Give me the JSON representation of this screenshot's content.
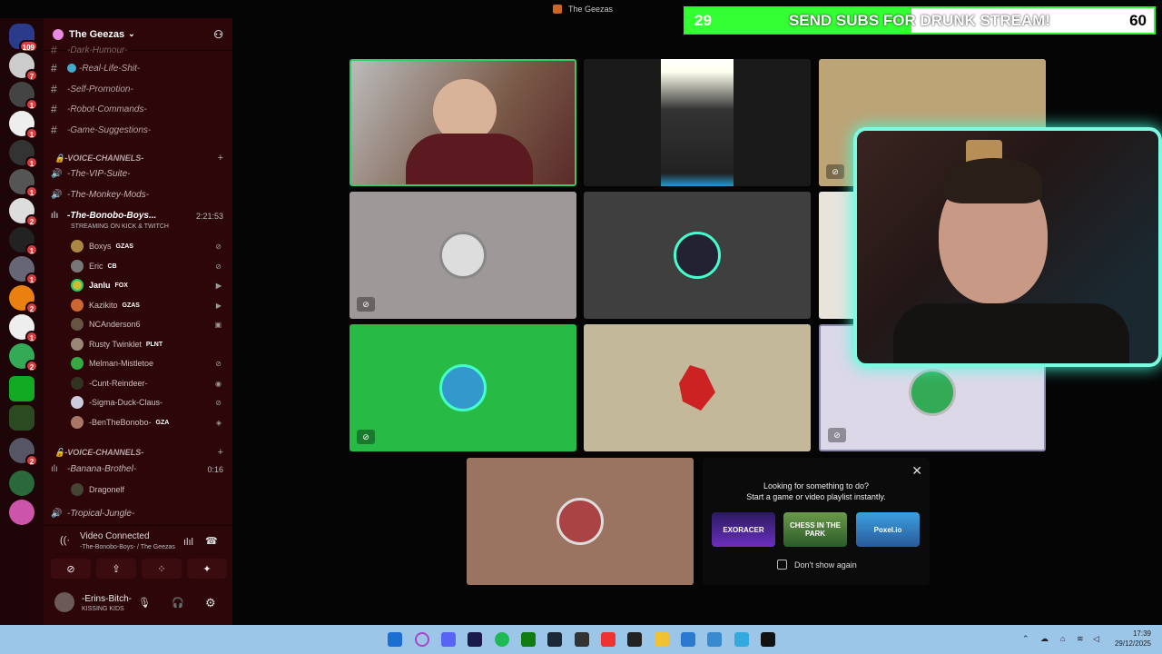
{
  "window": {
    "title": "The Geezas"
  },
  "server": {
    "name": "The Geezas"
  },
  "rail": {
    "home_badge": "109",
    "servers": [
      {
        "badge": "7"
      },
      {
        "badge": "1"
      },
      {
        "badge": "1"
      },
      {
        "badge": "1"
      },
      {
        "badge": "1"
      },
      {
        "badge": "2"
      },
      {
        "badge": "1"
      },
      {
        "badge": "1"
      },
      {
        "badge": "2"
      },
      {
        "badge": "1"
      },
      {
        "badge": "2"
      },
      {
        "badge": ""
      },
      {
        "badge": ""
      },
      {
        "badge": ""
      },
      {
        "badge": "2"
      },
      {
        "badge": ""
      },
      {
        "badge": ""
      }
    ]
  },
  "channels": {
    "text": [
      {
        "label": "-Dark-Humour-"
      },
      {
        "label": "-Real-Life-Shit-"
      },
      {
        "label": "-Self-Promotion-"
      },
      {
        "label": "-Robot-Commands-"
      },
      {
        "label": "-Game-Suggestions-"
      }
    ],
    "category1": "-VOICE-CHANNELS-",
    "voice": [
      {
        "label": "-The-VIP-Suite-"
      },
      {
        "label": "-The-Monkey-Mods-"
      }
    ],
    "active_voice": {
      "label": "-The-Bonobo-Boys...",
      "timer": "2:21:53",
      "note": "STREAMING ON KICK & TWITCH"
    },
    "users": [
      {
        "name": "Boxys",
        "tag": "GZAS"
      },
      {
        "name": "Eric",
        "tag": "CB"
      },
      {
        "name": "Janlu",
        "tag": "FOX"
      },
      {
        "name": "Kazikito",
        "tag": "GZAS"
      },
      {
        "name": "NCAnderson6",
        "tag": ""
      },
      {
        "name": "Rusty Twinklet",
        "tag": "PLNT"
      },
      {
        "name": "Melman-Mistletoe",
        "tag": ""
      },
      {
        "name": "-Cunt-Reindeer-",
        "tag": ""
      },
      {
        "name": "-Sigma-Duck-Claus-",
        "tag": ""
      },
      {
        "name": "-BenTheBonobo-",
        "tag": "GZA"
      }
    ],
    "category2": "-VOICE-CHANNELS-",
    "voice2": [
      {
        "label": "-Banana-Brothel-",
        "timer": "0:16"
      }
    ],
    "voice2_users": [
      {
        "name": "Dragonelf"
      }
    ],
    "voice3": {
      "label": "-Tropical-Jungle-"
    }
  },
  "voice_panel": {
    "status": "Video Connected",
    "channel": "-The-Bonobo-Boys- / The Geezas"
  },
  "me": {
    "name": "-Erins-Bitch-",
    "status": "KISSING KIDS"
  },
  "subgoal": {
    "current": "29",
    "label": "SEND SUBS FOR DRUNK STREAM!",
    "goal": "60",
    "progress": 0.483
  },
  "activities": {
    "line1": "Looking for something to do?",
    "line2": "Start a game or video playlist instantly.",
    "games": [
      "EXORACER",
      "CHESS IN THE PARK",
      "Poxel.io"
    ],
    "dont_show": "Don't show again"
  },
  "tray": {
    "time": "17:39",
    "date": "29/12/2025"
  },
  "colors": {
    "accent": "#2f2",
    "sidebar": "#2c0609",
    "rail": "#1e0508"
  }
}
